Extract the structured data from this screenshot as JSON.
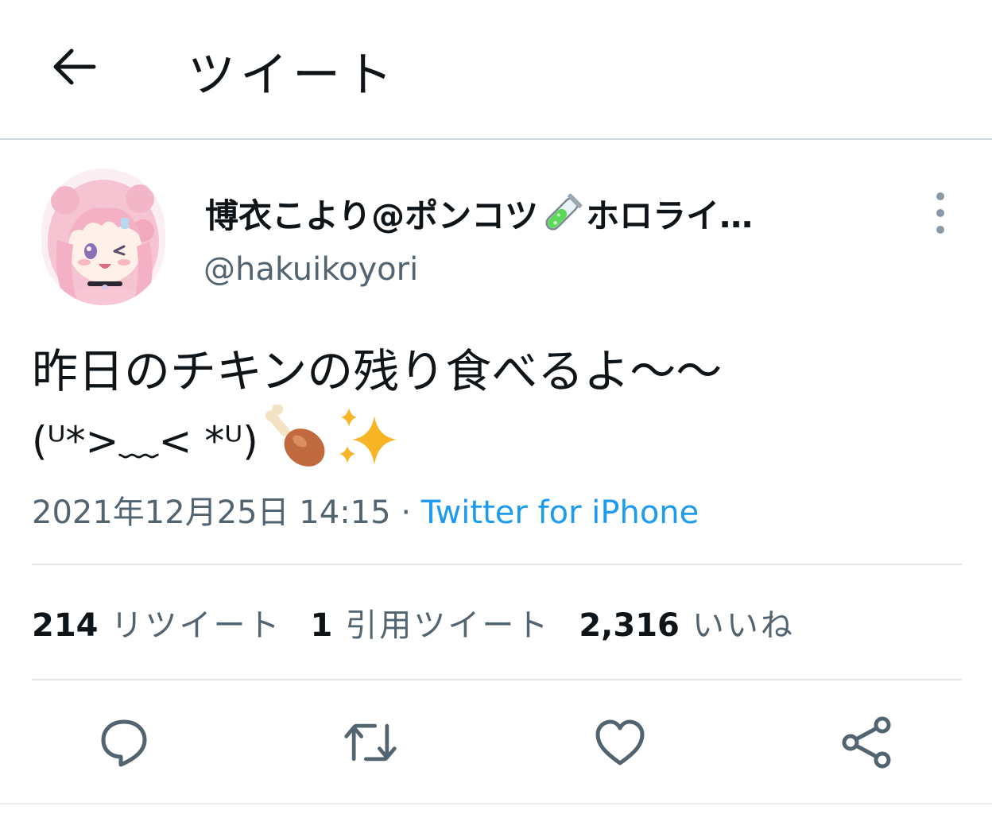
{
  "header": {
    "title": "ツイート",
    "back_icon": "back-arrow-icon"
  },
  "author": {
    "display_name_start": "博衣こより@ポンコツ",
    "display_name_end": "ホロライ…",
    "name_emoji": "test-tube-icon",
    "handle": "@hakuikoyori",
    "avatar": "avatar-image"
  },
  "tweet": {
    "line1": "昨日のチキンの残り食べるよ〜〜",
    "kaomoji": "(ᵁ*>﹏< *ᵁ)",
    "emojis": [
      "poultry-leg-icon",
      "sparkles-icon"
    ]
  },
  "meta": {
    "timestamp": "2021年12月25日 14:15",
    "separator": "·",
    "source": "Twitter for iPhone"
  },
  "stats": {
    "retweets": "214",
    "retweets_label": "リツイート",
    "quotes": "1",
    "quotes_label": "引用ツイート",
    "likes": "2,316",
    "likes_label": "いいね"
  },
  "actions": [
    "reply-icon",
    "retweet-icon",
    "like-icon",
    "share-icon"
  ],
  "colors": {
    "accent": "#1d9bf0",
    "secondary_text": "#536471",
    "primary_text": "#0f1419",
    "divider": "#dfe5e8"
  }
}
